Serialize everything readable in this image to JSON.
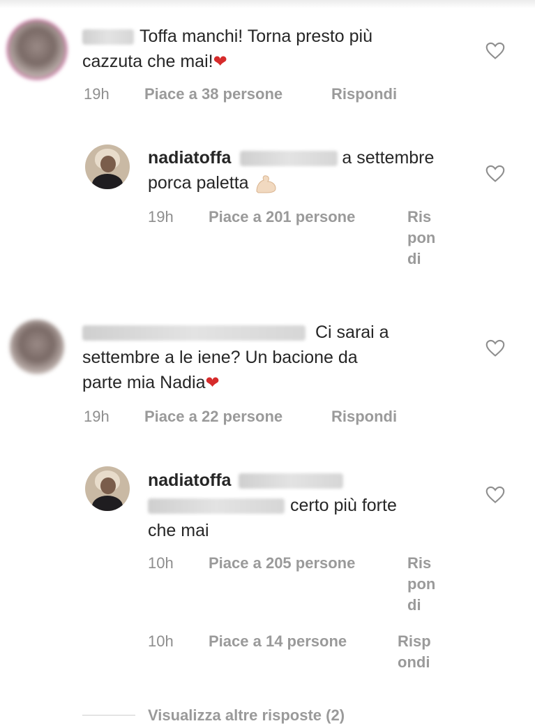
{
  "comments": [
    {
      "text": "Toffa manchi! Torna presto più",
      "text2": "cazzuta che mai!",
      "emoji": "heart-emoji",
      "time": "19h",
      "likes": "Piace a 38 persone",
      "reply": "Rispondi",
      "replies": [
        {
          "username": "nadiatoffa",
          "text": "a settembre",
          "text2": "porca paletta",
          "emoji": "flexed-biceps-emoji",
          "time": "19h",
          "likes": "Piace a 201 persone",
          "reply_lines": [
            "Ris",
            "pon",
            "di"
          ]
        }
      ]
    },
    {
      "text": "Ci sarai a",
      "text2": "settembre a le iene? Un bacione da",
      "text3": "parte mia Nadia",
      "emoji": "heart-emoji",
      "time": "19h",
      "likes": "Piace a 22 persone",
      "reply": "Rispondi",
      "replies": [
        {
          "username": "nadiatoffa",
          "text": "certo più forte",
          "text2": "che mai",
          "time": "10h",
          "likes": "Piace a 205 persone",
          "reply_lines": [
            "Ris",
            "pon",
            "di"
          ]
        }
      ],
      "extra_row": {
        "time": "10h",
        "likes": "Piace a 14 persone",
        "reply_lines": [
          "Risp",
          "ondi"
        ]
      },
      "view_more": "Visualizza altre risposte (2)"
    }
  ],
  "colors": {
    "text": "#262626",
    "meta": "#9a9a9a",
    "heart_emoji": "#d62b2b",
    "story_ring": "#b3337a"
  }
}
